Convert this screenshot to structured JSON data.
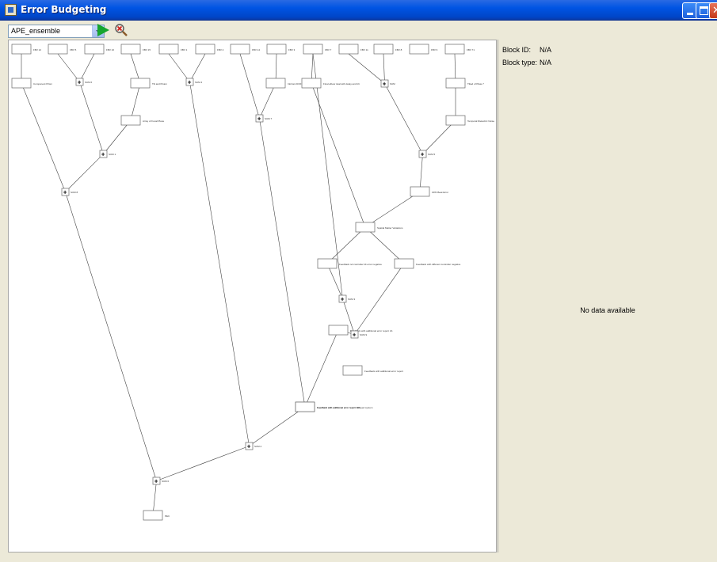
{
  "window": {
    "title": "Error Budgeting",
    "app_icon": "java-window-icon",
    "controls": [
      "minimize-icon",
      "maximize-icon",
      "close-icon"
    ]
  },
  "toolbar": {
    "model_select": {
      "value": "APE_ensemble"
    },
    "run_icon": "play-triangle-icon",
    "stop_icon": "magnifier-cancel-icon",
    "run_color": "#17a52e"
  },
  "info_panel": {
    "block_id_label": "Block ID:",
    "block_id_value": "N/A",
    "block_type_label": "Block type:",
    "block_type_value": "N/A",
    "empty_message": "No data available"
  },
  "diagram": {
    "sources": [
      {
        "label": "FBV 12"
      },
      {
        "label": "FBV 5"
      },
      {
        "label": "FBV 10"
      },
      {
        "label": "FBV 15"
      },
      {
        "label": "FBV 1"
      },
      {
        "label": "FBV 2"
      },
      {
        "label": "FBV 14"
      },
      {
        "label": "FBV 3"
      },
      {
        "label": "FBV 7"
      },
      {
        "label": "FBV 11"
      },
      {
        "label": "FBV 8"
      },
      {
        "label": "FBV 6"
      },
      {
        "label": "FBV 71"
      }
    ],
    "blocks": [
      {
        "label": "Component Prism"
      },
      {
        "label": "Tilt and Piston"
      },
      {
        "label": "Array of Focal Plane"
      },
      {
        "label": "Intrinsic DOF"
      },
      {
        "label": "Final elbow total with delay and tilt"
      },
      {
        "label": "Tilted of Plate 7"
      },
      {
        "label": "Temporal Dielectric Noise"
      },
      {
        "label": "OPD Beat Error"
      },
      {
        "label": "Spatial Matter Variations"
      },
      {
        "label": "Feedback ref controller tilt error negative"
      },
      {
        "label": "Feedback with different controller negative"
      },
      {
        "label": "Feedback with additional error report"
      },
      {
        "label": "Feedback with additional error report DR"
      },
      {
        "label": "Feedback with additional error report LS"
      },
      {
        "label": "Feedback with additional error report delayed system"
      },
      {
        "label": "PEC"
      }
    ],
    "sums": [
      {
        "label": "SUM 6"
      },
      {
        "label": "SUM 1"
      },
      {
        "label": "SUM 8"
      },
      {
        "label": "SUM 4"
      },
      {
        "label": "SUM 7"
      },
      {
        "label": "SUM"
      },
      {
        "label": "SUM 5"
      },
      {
        "label": "SUM 3"
      },
      {
        "label": "SUM 9"
      },
      {
        "label": "SUM 2"
      },
      {
        "label": "SUM 0"
      }
    ]
  }
}
